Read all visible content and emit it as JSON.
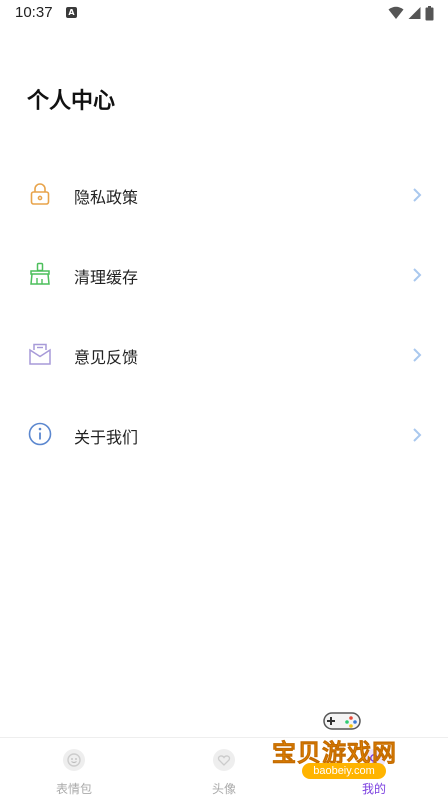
{
  "status_bar": {
    "time": "10:37",
    "notification_icon": "a-badge-icon"
  },
  "header": {
    "title": "个人中心"
  },
  "menu": {
    "items": [
      {
        "label": "隐私政策",
        "icon": "lock-icon",
        "color": "#e8a34a"
      },
      {
        "label": "清理缓存",
        "icon": "broom-icon",
        "color": "#4cbf5b"
      },
      {
        "label": "意见反馈",
        "icon": "mail-icon",
        "color": "#a79ad8"
      },
      {
        "label": "关于我们",
        "icon": "info-icon",
        "color": "#5b87cf"
      }
    ],
    "chevron_color": "#a9c8ee"
  },
  "bottom_nav": {
    "tabs": [
      {
        "label": "表情包",
        "active": false
      },
      {
        "label": "头像",
        "active": false
      },
      {
        "label": "我的",
        "active": true
      }
    ],
    "active_color": "#7b3fe0",
    "inactive_color": "#aaaaaa"
  },
  "watermark": {
    "name": "宝贝游戏网",
    "url": "baobeiy.com"
  }
}
